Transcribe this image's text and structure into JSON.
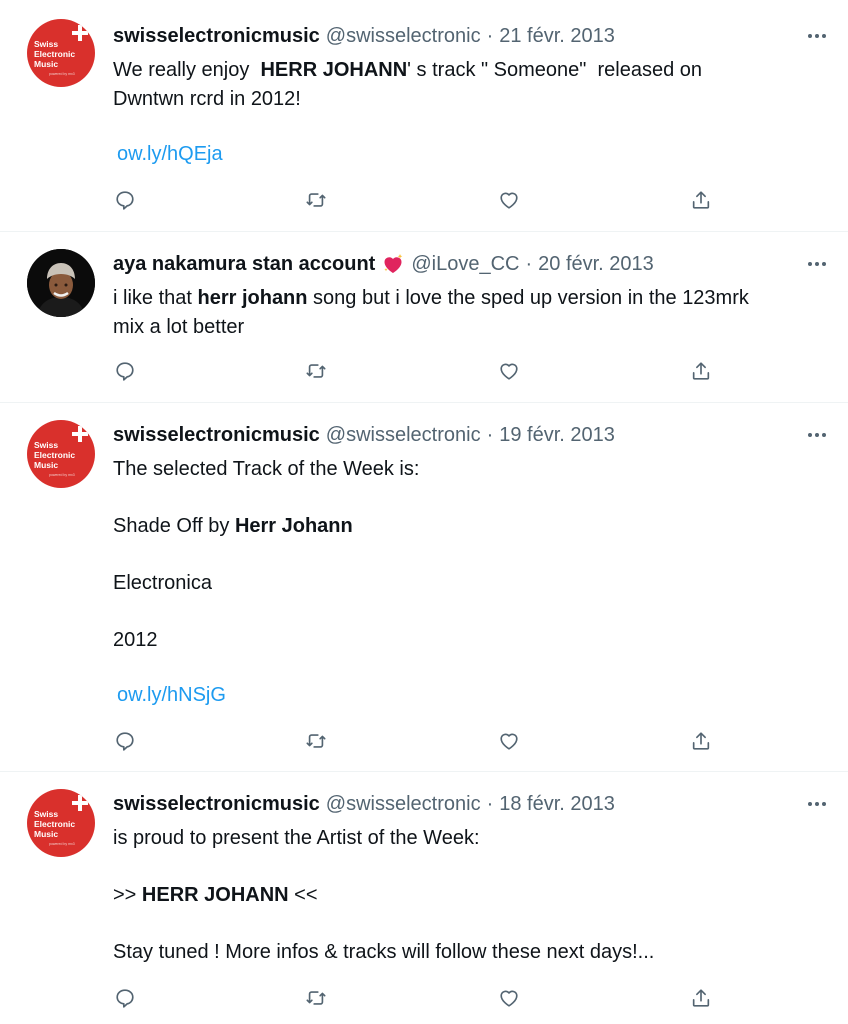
{
  "tweets": [
    {
      "display_name": "swisselectronicmusic",
      "handle": "@swisselectronic",
      "separator": "·",
      "date": "21 févr. 2013",
      "avatar": {
        "type": "logo",
        "line1": "Swiss",
        "line2": "Electronic",
        "line3": "Music",
        "tagline": "powered by mx3",
        "color": "#d9302c"
      },
      "text_parts": {
        "a": "We really enjoy  ",
        "b": "HERR JOHANN",
        "c": "' s track \" Someone\"  released on",
        "d": "Dwntwn rcrd in 2012!"
      },
      "link": "ow.ly/hQEja"
    },
    {
      "display_name": "aya nakamura stan account",
      "emoji": "sparkling-heart-icon",
      "handle": "@iLove_CC",
      "separator": "·",
      "date": "20 févr. 2013",
      "avatar": {
        "type": "photo"
      },
      "text_parts": {
        "a": "i like that ",
        "b": "herr johann",
        "c": " song but i love the sped up version in the 123mrk",
        "d": "mix a lot better"
      }
    },
    {
      "display_name": "swisselectronicmusic",
      "handle": "@swisselectronic",
      "separator": "·",
      "date": "19 févr. 2013",
      "avatar": {
        "type": "logo",
        "line1": "Swiss",
        "line2": "Electronic",
        "line3": "Music",
        "tagline": "powered by mx3",
        "color": "#d9302c"
      },
      "text_parts": {
        "a": "The selected Track of the Week is:",
        "b": "Shade Off by ",
        "c": "Herr Johann",
        "d": "Electronica",
        "e": "2012"
      },
      "link": "ow.ly/hNSjG"
    },
    {
      "display_name": "swisselectronicmusic",
      "handle": "@swisselectronic",
      "separator": "·",
      "date": "18 févr. 2013",
      "avatar": {
        "type": "logo",
        "line1": "Swiss",
        "line2": "Electronic",
        "line3": "Music",
        "tagline": "powered by mx3",
        "color": "#d9302c"
      },
      "text_parts": {
        "a": "is proud to present the Artist of the Week:",
        "b": ">> ",
        "c": "HERR JOHANN",
        "d": " <<",
        "e": "Stay tuned ! More infos & tracks will follow these next days!..."
      }
    }
  ],
  "actions": {
    "reply": "reply-icon",
    "retweet": "retweet-icon",
    "like": "heart-icon",
    "share": "share-icon"
  },
  "colors": {
    "text": "#0f1419",
    "secondary": "#536471",
    "link": "#1d9bf0",
    "divider": "#eff3f4",
    "brand_red": "#d9302c"
  }
}
